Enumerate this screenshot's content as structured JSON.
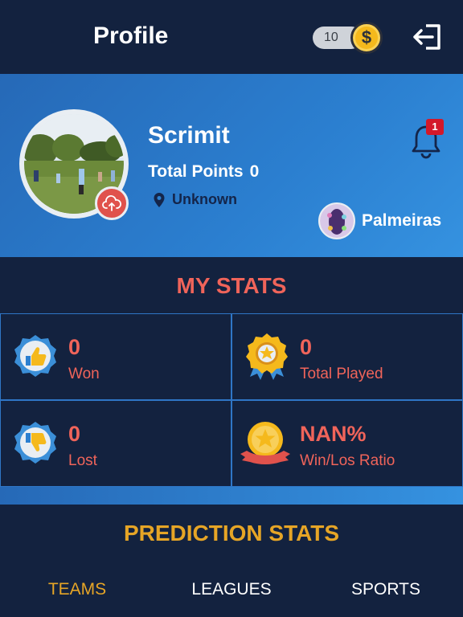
{
  "header": {
    "title": "Profile",
    "coin_count": "10",
    "coin_symbol": "$",
    "logout_icon": "logout-icon"
  },
  "profile": {
    "username": "Scrimit",
    "points_label": "Total Points",
    "points_value": "0",
    "location": "Unknown",
    "notifications_count": "1",
    "team_name": "Palmeiras"
  },
  "my_stats": {
    "title": "MY STATS",
    "items": [
      {
        "value": "0",
        "label": "Won",
        "icon": "thumbs-up-badge-icon"
      },
      {
        "value": "0",
        "label": "Total Played",
        "icon": "star-medal-icon"
      },
      {
        "value": "0",
        "label": "Lost",
        "icon": "thumbs-down-badge-icon"
      },
      {
        "value": "NAN%",
        "label": "Win/Los Ratio",
        "icon": "ribbon-medal-icon"
      }
    ]
  },
  "prediction_stats": {
    "title": "PREDICTION STATS",
    "tabs": [
      "TEAMS",
      "LEAGUES",
      "SPORTS"
    ],
    "active_tab": "TEAMS"
  },
  "colors": {
    "background": "#13223f",
    "accent_red": "#f0645a",
    "accent_gold": "#e6a526",
    "banner_blue": "#2b7fd0"
  }
}
